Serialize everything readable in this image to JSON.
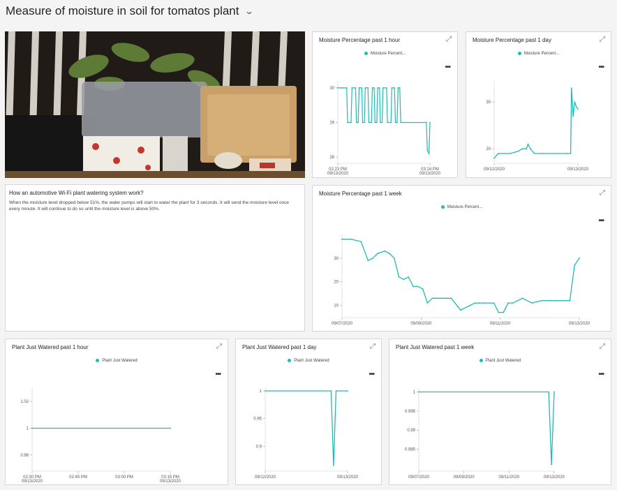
{
  "dashboard": {
    "title": "Measure of moisture in soil for tomatos plant"
  },
  "text_tile": {
    "heading": "How an automotive Wi-Fi plant watering system work?",
    "body": "When the moisture level dropped below 51%, the water pumps will start to water the plant for 3 seconds. It will send the moisture level once every minute. It will continue to do so until the moisture level is above 50%."
  },
  "colors": {
    "series": "#1fbbb4",
    "background": "#f4f4f4"
  },
  "tiles": [
    {
      "title": "Moisture Percentage past 1 hour",
      "legend": "Moisture Percent..."
    },
    {
      "title": "Moisture Percentage past 1 day",
      "legend": "Moisture Percent..."
    },
    {
      "title": "Moisture Percentage past 1 week",
      "legend": "Moisture Percent..."
    },
    {
      "title": "Plant Just Watered past 1 hour",
      "legend": "Plant Just Watered"
    },
    {
      "title": "Plant Just Watered past 1 day",
      "legend": "Plant Just Watered"
    },
    {
      "title": "Plant Just Watered past 1 week",
      "legend": "Plant Just Watered"
    }
  ],
  "chart_data": [
    {
      "type": "line",
      "title": "Moisture Percentage past 1 hour",
      "series": [
        {
          "name": "Moisture Percent...",
          "x": [
            0,
            0.05,
            0.1,
            0.11,
            0.15,
            0.16,
            0.2,
            0.21,
            0.23,
            0.24,
            0.27,
            0.28,
            0.3,
            0.31,
            0.34,
            0.35,
            0.38,
            0.39,
            0.41,
            0.42,
            0.44,
            0.45,
            0.47,
            0.48,
            0.5,
            0.51,
            0.55,
            0.56,
            0.6,
            0.61,
            0.64,
            0.65,
            0.67,
            0.68,
            0.7,
            0.71,
            1.0,
            1.01,
            1.03,
            1.04
          ],
          "values": [
            30,
            30,
            30,
            29,
            29,
            30,
            30,
            29,
            29,
            30,
            30,
            29,
            29,
            30,
            30,
            29,
            29,
            30,
            30,
            29,
            29,
            30,
            30,
            29,
            29,
            30,
            30,
            29,
            29,
            30,
            30,
            29,
            29,
            30,
            30,
            29,
            29,
            28.2,
            28.1,
            29
          ]
        }
      ],
      "yticks": [
        28,
        29,
        30
      ],
      "ylim": [
        27.9,
        30.2
      ],
      "xticks": [
        {
          "label": "02:23 PM",
          "sub": "09/13/2020"
        },
        {
          "label": "03:24 PM",
          "sub": "09/13/2020"
        }
      ]
    },
    {
      "type": "line",
      "title": "Moisture Percentage past 1 day",
      "series": [
        {
          "name": "Moisture Percent...",
          "x": [
            0,
            0.05,
            0.2,
            0.3,
            0.35,
            0.4,
            0.42,
            0.45,
            0.5,
            0.6,
            0.75,
            0.9,
            0.95,
            0.96,
            0.98,
            1.0,
            1.02,
            1.04
          ],
          "values": [
            18,
            19,
            19,
            19.5,
            20,
            20,
            21,
            20,
            19,
            19,
            19,
            19,
            19,
            33,
            27,
            30,
            29,
            28.5
          ]
        }
      ],
      "yticks": [
        20,
        30
      ],
      "ylim": [
        17.5,
        34.5
      ],
      "xticks": [
        {
          "label": "09/12/2020"
        },
        {
          "label": "09/13/2020"
        }
      ]
    },
    {
      "type": "line",
      "title": "Moisture Percentage past 1 week",
      "series": [
        {
          "name": "Moisture Percent...",
          "x": [
            0,
            0.04,
            0.08,
            0.11,
            0.13,
            0.15,
            0.18,
            0.2,
            0.22,
            0.24,
            0.26,
            0.28,
            0.3,
            0.32,
            0.34,
            0.36,
            0.38,
            0.4,
            0.42,
            0.44,
            0.46,
            0.5,
            0.54,
            0.56,
            0.58,
            0.6,
            0.64,
            0.66,
            0.68,
            0.7,
            0.72,
            0.74,
            0.76,
            0.8,
            0.84,
            0.88,
            0.9,
            0.94,
            0.96,
            0.98,
            1.0
          ],
          "values": [
            38,
            38,
            37,
            29,
            30,
            32,
            33,
            32,
            30,
            22,
            21,
            22,
            18,
            18,
            17,
            11,
            13,
            13,
            13,
            13,
            13,
            8,
            10,
            11,
            11,
            11,
            11,
            7,
            7,
            11,
            11,
            12,
            13,
            11,
            12,
            12,
            12,
            12,
            12,
            27,
            30
          ]
        }
      ],
      "yticks": [
        10,
        20,
        30
      ],
      "ylim": [
        6,
        40
      ],
      "xticks": [
        {
          "label": "09/07/2020"
        },
        {
          "label": "09/09/2020"
        },
        {
          "label": "09/11/2020"
        },
        {
          "label": "09/13/2020"
        }
      ]
    },
    {
      "type": "line",
      "title": "Plant Just Watered past 1 hour",
      "series": [
        {
          "name": "Plant Just Watered",
          "x": [
            0,
            1
          ],
          "values": [
            1,
            1
          ]
        }
      ],
      "yticks": [
        0.98,
        1,
        1.02
      ],
      "yticklabels": [
        "0.98",
        "1",
        "1.02"
      ],
      "ylim": [
        0.97,
        1.03
      ],
      "xticks": [
        {
          "label": "02:30 PM",
          "sub": "09/13/2020"
        },
        {
          "label": "02:45 PM"
        },
        {
          "label": "03:00 PM"
        },
        {
          "label": "03:15 PM",
          "sub": "09/13/2020"
        }
      ]
    },
    {
      "type": "line",
      "title": "Plant Just Watered past 1 day",
      "series": [
        {
          "name": "Plant Just Watered",
          "x": [
            0,
            0.8,
            0.83,
            0.86,
            1.0
          ],
          "values": [
            1,
            1,
            0.865,
            1,
            1
          ]
        }
      ],
      "yticks": [
        0.9,
        0.95,
        1
      ],
      "yticklabels": [
        "0.9",
        "0.95",
        "1"
      ],
      "ylim": [
        0.86,
        1.005
      ],
      "xticks": [
        {
          "label": "09/12/2020"
        },
        {
          "label": "09/13/2020"
        }
      ]
    },
    {
      "type": "line",
      "title": "Plant Just Watered past 1 week",
      "series": [
        {
          "name": "Plant Just Watered",
          "x": [
            0,
            0.96,
            0.98,
            1.0
          ],
          "values": [
            1,
            1,
            0.981,
            1
          ]
        }
      ],
      "yticks": [
        0.985,
        0.99,
        0.995,
        1
      ],
      "yticklabels": [
        "0.985",
        "0.99",
        "0.995",
        "1"
      ],
      "ylim": [
        0.98,
        1.001
      ],
      "xticks": [
        {
          "label": "09/07/2020"
        },
        {
          "label": "09/09/2020"
        },
        {
          "label": "09/11/2020"
        },
        {
          "label": "09/13/2020"
        }
      ]
    }
  ]
}
